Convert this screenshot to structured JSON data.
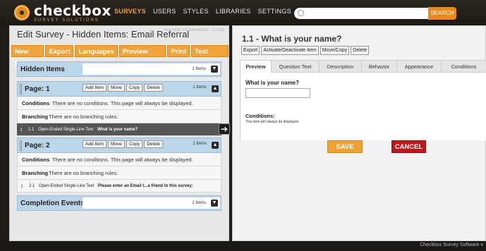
{
  "header": {
    "logo_name": "checkbox",
    "logo_sub": "SURVEY SOLUTIONS",
    "nav": [
      "SURVEYS",
      "USERS",
      "STYLES",
      "LIBRARIES",
      "SETTINGS"
    ],
    "search_button": "SEARCH"
  },
  "left": {
    "title": "Edit Survey - Hidden Items: Email Referral",
    "return_link": "RETURN TO MANAGER",
    "close_link": "CLOSE",
    "toolbar": [
      "New Page",
      "Export",
      "Languages",
      "Preview Survey",
      "Print",
      "Test Survey"
    ],
    "hidden_items": {
      "title": "Hidden Items",
      "count": "1 Items"
    },
    "page_buttons": [
      "Add Item",
      "Move",
      "Copy",
      "Delete"
    ],
    "pages": [
      {
        "title": "Page: 1",
        "count": "1 Items",
        "conditions_label": "Conditions",
        "conditions_text": "There are no conditions. This page will always be displayed.",
        "branching_label": "Branching",
        "branching_text": "There are no branching rules.",
        "item": {
          "num": "1.1",
          "type": "Open-Ended Single-Line Text",
          "question": "What is your name?"
        }
      },
      {
        "title": "Page: 2",
        "count": "1 Items",
        "conditions_label": "Conditions",
        "conditions_text": "There are no conditions. This page will always be displayed.",
        "branching_label": "Branching",
        "branching_text": "There are no branching rules.",
        "item": {
          "num": "2.1",
          "type": "Open-Ended Single-Line Text",
          "question": "Please enter an Email t...a friend to this survey:"
        }
      }
    ],
    "completion": {
      "title": "Completion Events",
      "count": "2 Items"
    }
  },
  "right": {
    "title": "1.1 - What is your name?",
    "item_buttons": [
      "Export",
      "Activate/Deactivate Item",
      "Move/Copy",
      "Delete"
    ],
    "tabs": [
      "Preview",
      "Question Text",
      "Description",
      "Behavior",
      "Appearance",
      "Conditions"
    ],
    "active_tab": "Preview",
    "prompt": "What is your name?",
    "conditions_label": "Conditions:",
    "conditions_text": "This item will always be displayed.",
    "save_label": "SAVE",
    "cancel_label": "CANCEL"
  },
  "footer": {
    "text": "Checkbox Survey Software v"
  },
  "colors": {
    "accent_orange": "#f0a33a",
    "cancel_red": "#c0161c",
    "header_blue": "#bcd6e9"
  }
}
